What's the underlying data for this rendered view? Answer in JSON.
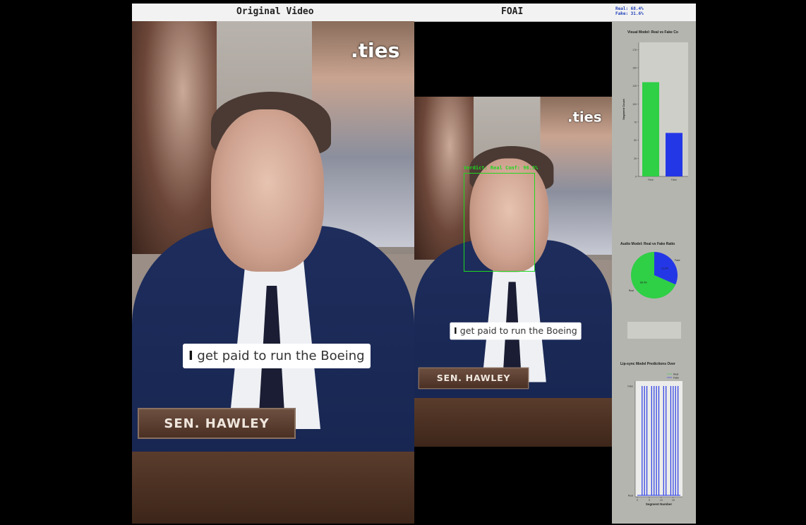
{
  "header": {
    "original_title": "Original Video",
    "app_title": "FOAI",
    "real_stat": "Real: 68.4%",
    "fake_stat": "Fake: 31.6%"
  },
  "video": {
    "caption_bold": "I",
    "caption_rest": " get paid to run the Boeing",
    "nameplate": "SEN. HAWLEY",
    "watermark": ".ties",
    "verdict": "Verdict: Real Conf: 96.5%"
  },
  "panel": {
    "visual_title": "Visual Model: Real vs Fake Co",
    "audio_title": "Audio Model: Real vs Fake Ratio",
    "lipsync_title": "Lip-sync Model Predictions Over",
    "lipsync_xlabel": "Segment Number"
  },
  "chart_data": [
    {
      "type": "bar",
      "title": "Visual Model: Real vs Fake Co",
      "categories": [
        "Real",
        "Fake"
      ],
      "values": [
        130,
        60
      ],
      "ylabel": "Segment Count",
      "ylim": [
        0,
        185
      ],
      "colors": [
        "#2fcf46",
        "#2437e6"
      ]
    },
    {
      "type": "pie",
      "title": "Audio Model: Real vs Fake Ratio",
      "labels": [
        "Real",
        "Fake"
      ],
      "values": [
        68.4,
        31.6
      ],
      "colors": [
        "#2fcf46",
        "#2437e6"
      ]
    },
    {
      "type": "bar",
      "title": "Lip-sync Model Predictions Over",
      "xlabel": "Segment Number",
      "categories_y": [
        "Fake",
        "Real"
      ],
      "legend": [
        "Real",
        "Fake"
      ],
      "color": "#2437e6",
      "fake_segments": [
        2,
        3,
        4,
        6,
        7,
        8,
        9,
        11,
        12,
        14,
        15,
        16,
        17
      ],
      "total_segments": 18
    }
  ]
}
